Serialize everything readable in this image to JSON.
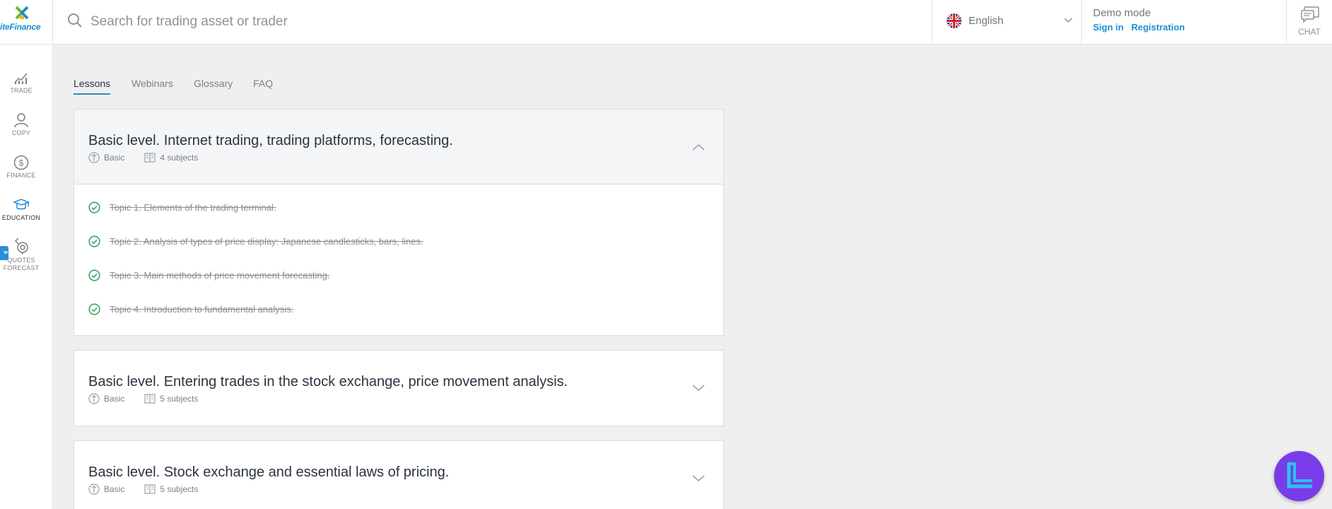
{
  "header": {
    "logo_text": "iteFinance",
    "search_placeholder": "Search for trading asset or trader",
    "language": "English",
    "demo_mode": "Demo mode",
    "sign_in": "Sign in",
    "registration": "Registration",
    "chat": "CHAT"
  },
  "sidebar": {
    "items": [
      {
        "label": "TRADE",
        "icon": "chart-icon"
      },
      {
        "label": "COPY",
        "icon": "user-icon"
      },
      {
        "label": "FINANCE",
        "icon": "dollar-icon"
      },
      {
        "label": "EDUCATION",
        "icon": "graduation-cap-icon",
        "active": true
      },
      {
        "label_line1": "QUOTES",
        "label_line2": "FORECAST",
        "icon": "forecast-icon",
        "badge": "w"
      }
    ]
  },
  "tabs": [
    {
      "label": "Lessons",
      "active": true
    },
    {
      "label": "Webinars"
    },
    {
      "label": "Glossary"
    },
    {
      "label": "FAQ"
    }
  ],
  "lessons": [
    {
      "title": "Basic level. Internet trading, trading platforms, forecasting.",
      "level": "Basic",
      "subjects": "4 subjects",
      "expanded": true,
      "topics": [
        "Topic 1. Elements of the trading terminal.",
        "Topic 2. Analysis of types of price display: Japanese candlesticks, bars, lines.",
        "Topic 3. Main methods of price movement forecasting.",
        "Topic 4. Introduction to fundamental analysis."
      ]
    },
    {
      "title": "Basic level. Entering trades in the stock exchange, price movement analysis.",
      "level": "Basic",
      "subjects": "5 subjects",
      "expanded": false
    },
    {
      "title": "Basic level. Stock exchange and essential laws of pricing.",
      "level": "Basic",
      "subjects": "5 subjects",
      "expanded": false
    }
  ],
  "colors": {
    "accent_blue": "#1f8dd6",
    "check_green": "#3aa564",
    "brand_purple": "#7a3ce8"
  }
}
